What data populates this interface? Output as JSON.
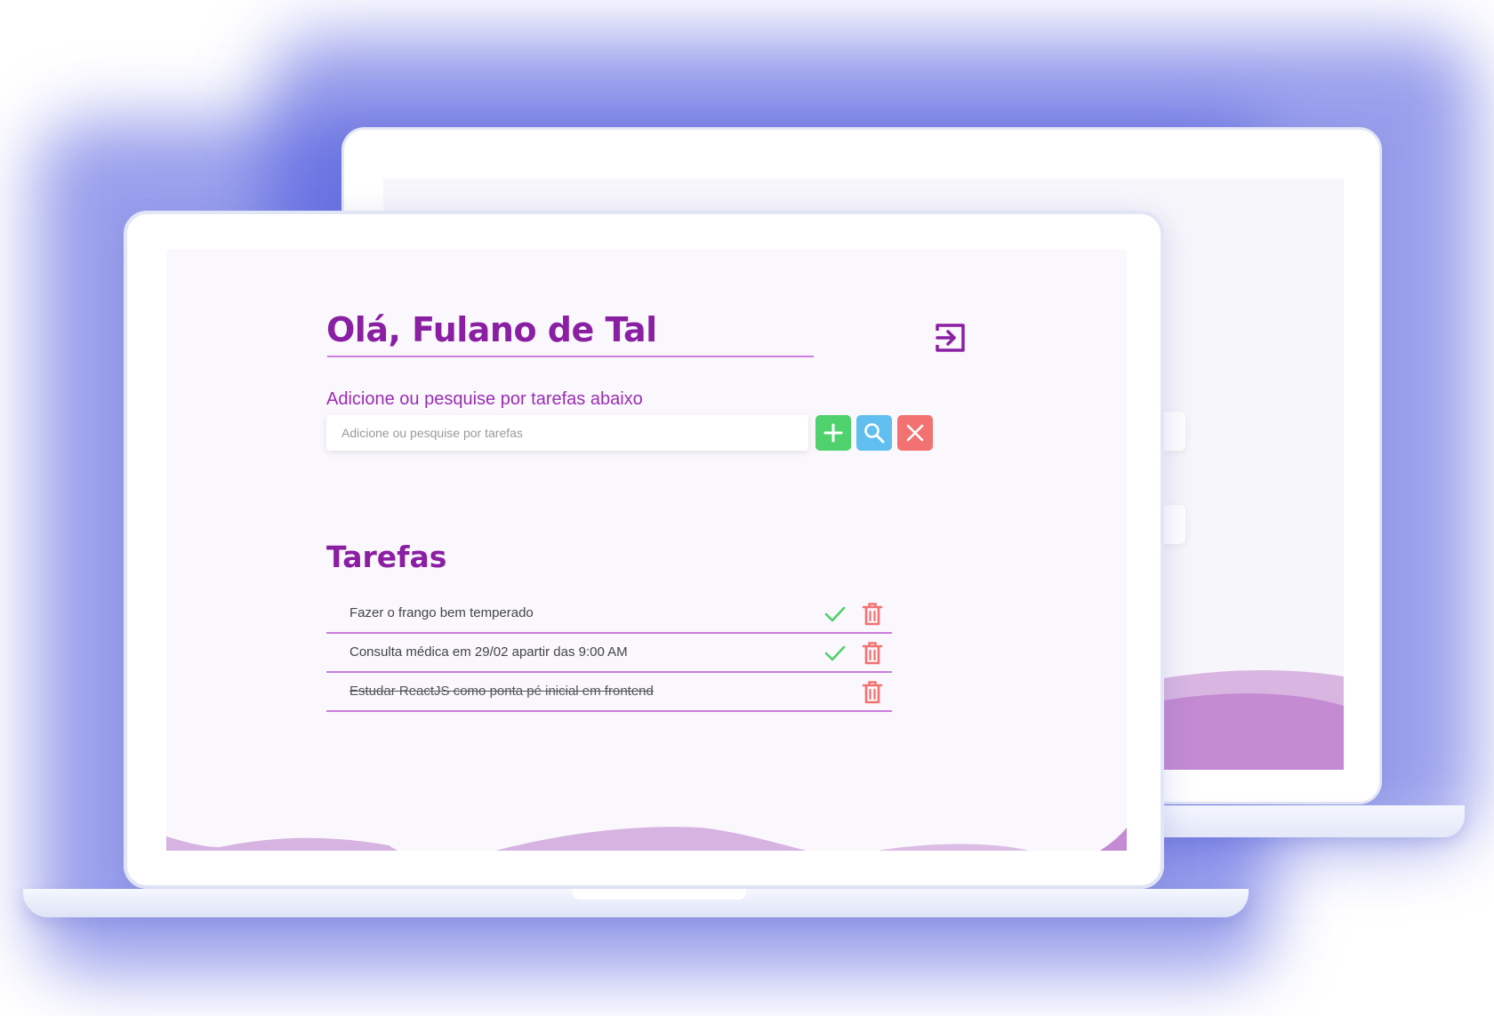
{
  "header": {
    "greeting": "Olá, Fulano de Tal",
    "logout_icon": "logout-icon"
  },
  "form": {
    "subtitle": "Adicione ou pesquise por tarefas abaixo",
    "input_placeholder": "Adicione ou pesquise por tarefas",
    "input_value": "",
    "buttons": [
      {
        "name": "add",
        "icon": "plus-icon",
        "color": "#4fd16d"
      },
      {
        "name": "search",
        "icon": "search-icon",
        "color": "#61bff0"
      },
      {
        "name": "clear",
        "icon": "close-icon",
        "color": "#f27272"
      }
    ]
  },
  "tasks": {
    "title": "Tarefas",
    "items": [
      {
        "text": "Fazer o frango bem temperado",
        "done": false
      },
      {
        "text": "Consulta médica em 29/02 apartir das 9:00 AM",
        "done": false
      },
      {
        "text": "Estudar ReactJS como ponta pé inicial em frontend",
        "done": true
      }
    ]
  },
  "colors": {
    "brand": "#8a1fa3",
    "accent_line": "#c97fdc",
    "check": "#4fd16d",
    "trash": "#f27272",
    "wave": "#c690d4"
  }
}
